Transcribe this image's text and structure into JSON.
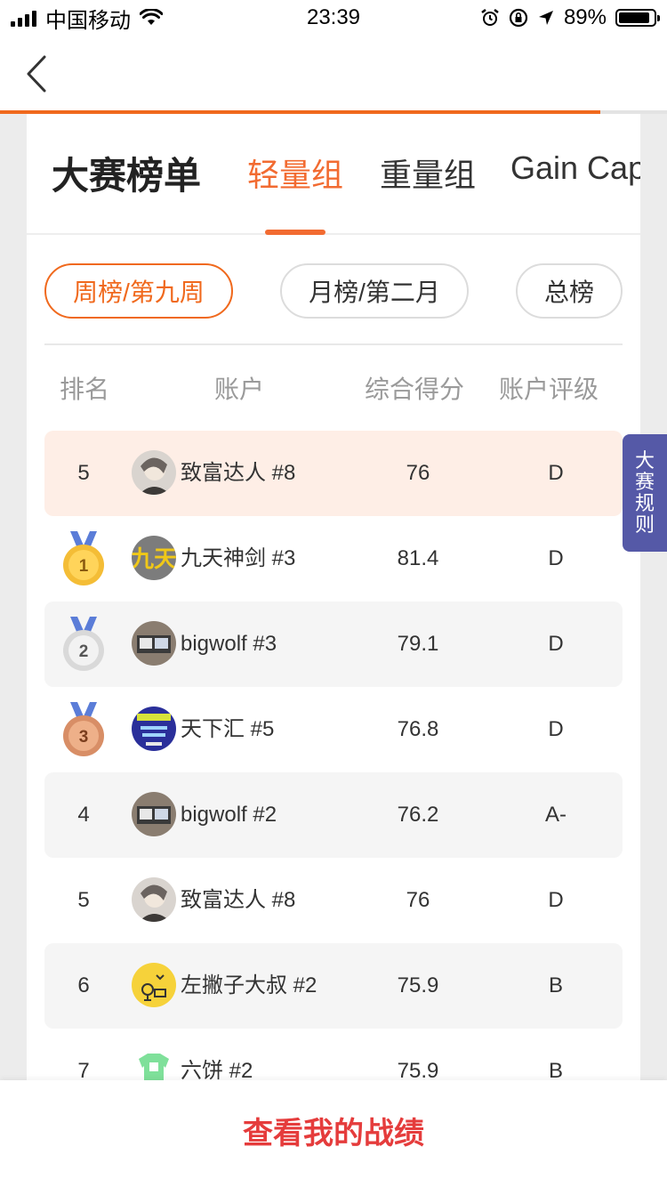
{
  "status_bar": {
    "carrier": "中国移动",
    "time": "23:39",
    "battery": "89%",
    "battery_level": 0.89
  },
  "nav": {
    "back_icon": "chevron-left-icon",
    "load_progress": 0.9
  },
  "header": {
    "title": "大赛榜单",
    "tabs": [
      "轻量组",
      "重量组",
      "Gain Cap"
    ],
    "active_tab": 0
  },
  "period_filters": [
    "周榜/第九周",
    "月榜/第二月",
    "总榜"
  ],
  "table": {
    "columns": [
      "排名",
      "账户",
      "综合得分",
      "账户评级"
    ],
    "my_row": {
      "rank": "5",
      "account": "致富达人 #8",
      "score": "76",
      "grade": "D"
    },
    "rows": [
      {
        "rank": "1",
        "medal": "gold",
        "account": "九天神剑 #3",
        "score": "81.4",
        "grade": "D"
      },
      {
        "rank": "2",
        "medal": "silver",
        "account": "bigwolf #3",
        "score": "79.1",
        "grade": "D"
      },
      {
        "rank": "3",
        "medal": "bronze",
        "account": "天下汇 #5",
        "score": "76.8",
        "grade": "D"
      },
      {
        "rank": "4",
        "account": "bigwolf #2",
        "score": "76.2",
        "grade": "A-"
      },
      {
        "rank": "5",
        "account": "致富达人 #8",
        "score": "76",
        "grade": "D"
      },
      {
        "rank": "6",
        "account": "左撇子大叔 #2",
        "score": "75.9",
        "grade": "B"
      },
      {
        "rank": "7",
        "account": "六饼 #2",
        "score": "75.9",
        "grade": "B"
      }
    ]
  },
  "side_tab": {
    "label": [
      "大",
      "赛",
      "规",
      "则"
    ]
  },
  "footer": {
    "button": "查看我的战绩"
  },
  "colors": {
    "accent": "#f26b31",
    "footer_text": "#e53c3c",
    "side_tab": "#5559a7"
  }
}
